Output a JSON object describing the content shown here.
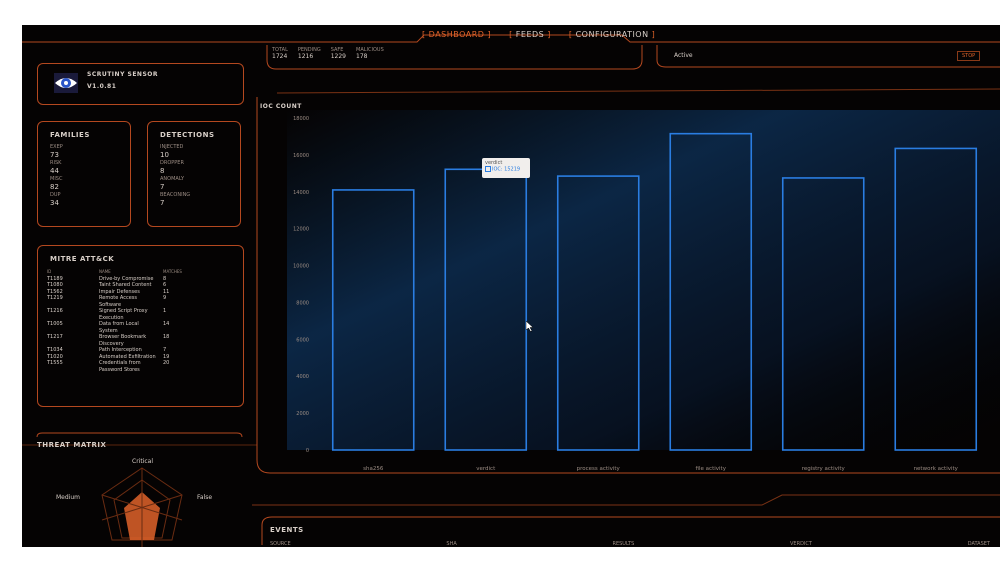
{
  "nav": {
    "tabs": [
      {
        "label": "DASHBOARD",
        "active": true
      },
      {
        "label": "FEEDS",
        "active": false
      },
      {
        "label": "CONFIGURATION",
        "active": false
      }
    ]
  },
  "top_stats": {
    "labels": [
      "TOTAL",
      "PENDING",
      "SAFE",
      "MALICIOUS"
    ],
    "values": [
      "1724",
      "1216",
      "1229",
      "178"
    ]
  },
  "status": {
    "text": "Active",
    "button_label": "STOP"
  },
  "sensor": {
    "name": "SCRUTINY SENSOR",
    "version": "V1.0.81"
  },
  "families": {
    "title": "FAMILIES",
    "items": [
      {
        "label": "EXEP",
        "value": "73"
      },
      {
        "label": "RISK",
        "value": "44"
      },
      {
        "label": "MISC",
        "value": "82"
      },
      {
        "label": "DUP",
        "value": "34"
      }
    ]
  },
  "detections": {
    "title": "DETECTIONS",
    "items": [
      {
        "label": "INJECTED",
        "value": "10"
      },
      {
        "label": "DROPPER",
        "value": "8"
      },
      {
        "label": "ANOMALY",
        "value": "7"
      },
      {
        "label": "BEACONING",
        "value": "7"
      }
    ]
  },
  "mitre": {
    "title": "MITRE ATT&CK",
    "headers": [
      "ID",
      "NAME",
      "MATCHES"
    ],
    "rows": [
      {
        "id": "T1189",
        "name": "Drive-by Compromise",
        "count": "8"
      },
      {
        "id": "T1080",
        "name": "Taint Shared Content",
        "count": "6"
      },
      {
        "id": "T1562",
        "name": "Impair Defenses",
        "count": "11"
      },
      {
        "id": "T1219",
        "name": "Remote Access",
        "count": "9"
      },
      {
        "id": "",
        "name": "Software",
        "count": ""
      },
      {
        "id": "T1216",
        "name": "Signed Script Proxy",
        "count": "1"
      },
      {
        "id": "",
        "name": "Execution",
        "count": ""
      },
      {
        "id": "T1005",
        "name": "Data from Local",
        "count": "14"
      },
      {
        "id": "",
        "name": "System",
        "count": ""
      },
      {
        "id": "T1217",
        "name": "Browser Bookmark",
        "count": "18"
      },
      {
        "id": "",
        "name": "Discovery",
        "count": ""
      },
      {
        "id": "T1034",
        "name": "Path Interception",
        "count": "7"
      },
      {
        "id": "T1020",
        "name": "Automated Exfiltration",
        "count": "19"
      },
      {
        "id": "T1555",
        "name": "Credentials from",
        "count": "20"
      },
      {
        "id": "",
        "name": "Password Stores",
        "count": ""
      }
    ]
  },
  "threat_matrix": {
    "title": "THREAT MATRIX",
    "labels": [
      "Critical",
      "Medium",
      "False"
    ]
  },
  "chart_title": "IOC COUNT",
  "tooltip": {
    "title": "verdict",
    "text": "IOC: 15219"
  },
  "events": {
    "title": "EVENTS",
    "columns": [
      "SOURCE",
      "SHA",
      "RESULTS",
      "VERDICT",
      "DATASET"
    ]
  },
  "chart_data": {
    "type": "bar",
    "categories": [
      "sha256",
      "verdict",
      "process activity",
      "file activity",
      "registry activity",
      "network activity"
    ],
    "values": [
      14100,
      15219,
      14850,
      17150,
      14750,
      16350
    ],
    "ylim": [
      0,
      18000
    ],
    "yticks": [
      0,
      2000,
      4000,
      6000,
      8000,
      10000,
      12000,
      14000,
      16000,
      18000
    ],
    "grid": false,
    "bar_color": "#2a7de1"
  }
}
